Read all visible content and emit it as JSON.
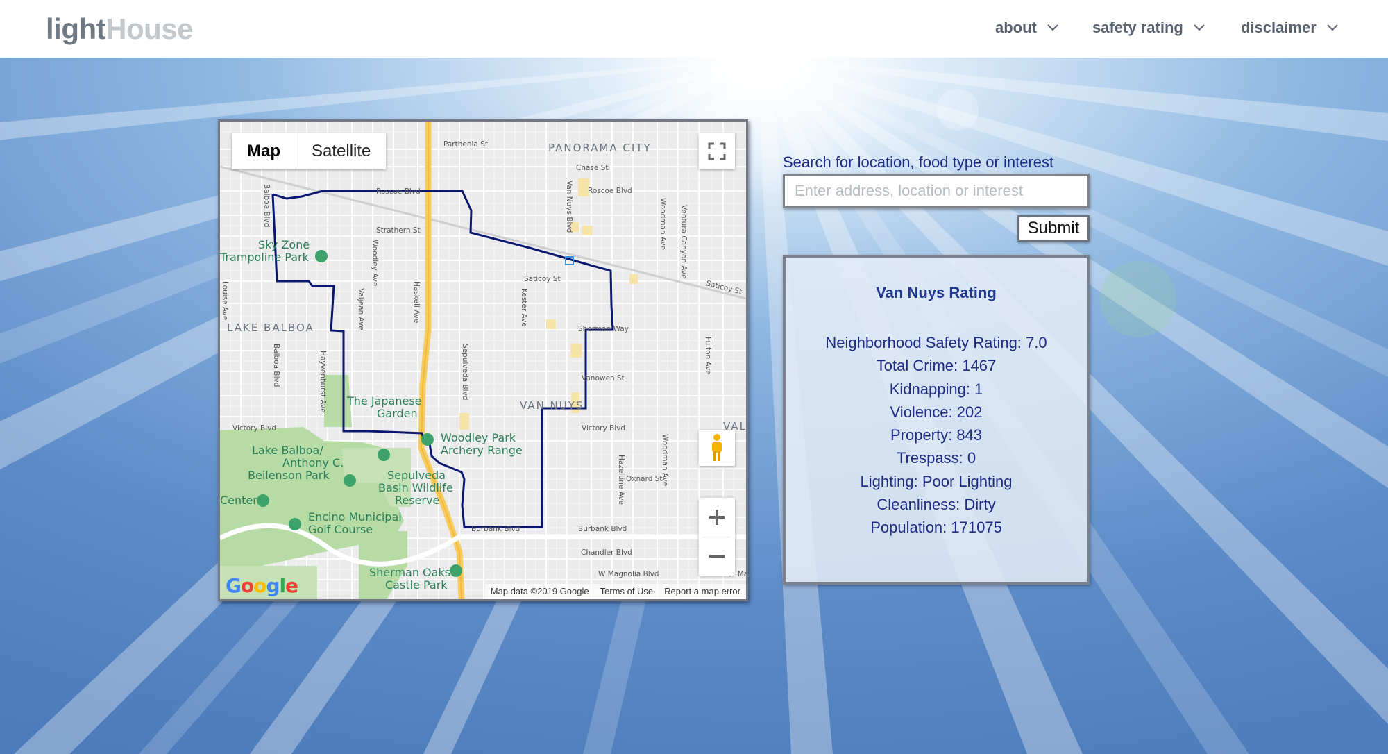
{
  "header": {
    "logo_part1": "light",
    "logo_part2": "House",
    "nav": [
      {
        "label": "about"
      },
      {
        "label": "safety rating"
      },
      {
        "label": "disclaimer"
      }
    ]
  },
  "map": {
    "type_map": "Map",
    "type_satellite": "Satellite",
    "google_logo": "Google",
    "footer": {
      "map_data": "Map data ©2019 Google",
      "terms": "Terms of Use",
      "report": "Report a map error"
    },
    "labels": {
      "panorama_city": "PANORAMA CITY",
      "lake_balboa": "LAKE BALBOA",
      "van_nuys": "VAN NUYS",
      "val": "VAL",
      "sky_zone_1": "Sky Zone",
      "sky_zone_2": "Trampoline Park",
      "japanese_garden_1": "The Japanese",
      "japanese_garden_2": "Garden",
      "woodley_1": "Woodley Park",
      "woodley_2": "Archery Range",
      "lake_balboa_park_1": "Lake Balboa/",
      "lake_balboa_park_2": "Anthony C.",
      "lake_balboa_park_3": "Beilenson Park",
      "sepulveda_1": "Sepulveda",
      "sepulveda_2": "Basin Wildlife",
      "sepulveda_3": "Reserve",
      "center": "Center",
      "encino_1": "Encino Municipal",
      "encino_2": "Golf Course",
      "sherman_1": "Sherman Oaks",
      "sherman_2": "Castle Park",
      "parthenia": "Parthenia St",
      "chase": "Chase St",
      "roscoe_w": "Roscoe Blvd",
      "roscoe_e": "Roscoe Blvd",
      "strathern": "Strathern St",
      "saticoy_w": "Saticoy St",
      "saticoy_e": "Saticoy St",
      "sherman_way": "Sherman Way",
      "vanowen": "Vanowen St",
      "victory_w": "Victory Blvd",
      "victory_e": "Victory Blvd",
      "oxnard": "Oxnard St",
      "burbank_w": "Burbank Blvd",
      "burbank_e": "Burbank Blvd",
      "chandler": "Chandler Blvd",
      "magnolia": "W Magnolia Blvd",
      "w_ma": "W Ma",
      "balboa_n": "Balboa Blvd",
      "balboa_s": "Balboa Blvd",
      "louise": "Louise Ave",
      "woodley": "Woodley Ave",
      "valjean": "Valjean Ave",
      "haskell": "Haskell Ave",
      "hayvenhurst": "Hayvenhurst Ave",
      "sepulveda_blvd": "Sepulveda Blvd",
      "kester": "Kester Ave",
      "van_nuys_blvd": "Van Nuys Blvd",
      "woodman_n": "Woodman Ave",
      "woodman_s": "Woodman Ave",
      "ventura_canyon": "Ventura Canyon Ave",
      "fulton": "Fulton Ave",
      "hazeltine": "Hazeltine Ave"
    }
  },
  "search": {
    "label": "Search for location, food type or interest",
    "placeholder": "Enter address, location or interest",
    "value": "",
    "submit_label": "Submit"
  },
  "rating": {
    "title": "Van Nuys Rating",
    "items": [
      "Neighborhood Safety Rating: 7.0",
      "Total Crime: 1467",
      "Kidnapping: 1",
      "Violence: 202",
      "Property: 843",
      "Trespass: 0",
      "Lighting: Poor Lighting",
      "Cleanliness: Dirty",
      "Population: 171075"
    ]
  },
  "colors": {
    "accent": "#1f2c86",
    "boundary": "#0d1a6e",
    "park": "#b5dba3",
    "highway": "#f6cc62"
  }
}
